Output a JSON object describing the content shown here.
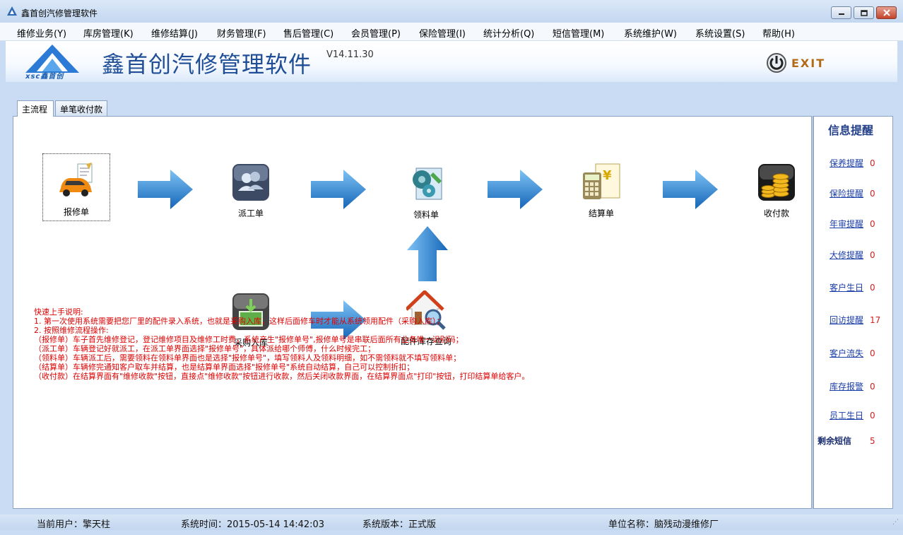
{
  "window": {
    "title": "鑫首创汽修管理软件"
  },
  "menu": [
    "维修业务(Y)",
    "库房管理(K)",
    "维修结算(J)",
    "财务管理(F)",
    "售后管理(C)",
    "会员管理(P)",
    "保险管理(I)",
    "统计分析(Q)",
    "短信管理(M)",
    "系统维护(W)",
    "系统设置(S)",
    "帮助(H)"
  ],
  "header": {
    "logo_text": "xsc鑫首创",
    "app_name": "鑫首创汽修管理软件",
    "version": "V14.11.30",
    "exit_label": "EXIT"
  },
  "tabs": [
    "主流程",
    "单笔收付款"
  ],
  "flow": {
    "repair_order": "报修单",
    "dispatch": "派工单",
    "picking": "领料单",
    "settlement": "结算单",
    "payment": "收付款",
    "purchase_in": "采购入库",
    "parts_query": "配件库存查询"
  },
  "instructions": [
    "快速上手说明:",
    "1.   第一次使用系统需要把您厂里的配件录入系统，也就是采购入库，这样后面修车时才能从系统领用配件（采购入库）；",
    "2.   按照维修流程操作:",
    "      （报修单）车子首先维修登记，登记维修项目及维修工时费，系统产生\"报修单号\",报修单号是串联后面所有业务唯一识别码；",
    "      （派工单）车辆登记好就派工，在派工单界面选择\"报修单号\"，具体派给哪个师傅，什么时候完工；",
    "      （领料单）车辆派工后，需要领料在领料单界面也是选择\"报修单号\"，填写领料人及领料明细，如不需领料就不填写领料单；",
    "      （结算单）车辆修完通知客户取车并结算，也是结算单界面选择\"报修单号\"系统自动结算，自己可以控制折扣；",
    "      （收付款）在结算界面有\"维修收款\"按钮，直接点\"维修收款\"按钮进行收款，然后关闭收款界面，在结算界面点\"打印\"按钮，打印结算单给客户。"
  ],
  "sidebar": {
    "title": "信息提醒",
    "items": [
      {
        "label": "保养提醒",
        "count": "0"
      },
      {
        "label": "保险提醒",
        "count": "0"
      },
      {
        "label": "年审提醒",
        "count": "0"
      },
      {
        "label": "大修提醒",
        "count": "0"
      },
      {
        "label": "客户生日",
        "count": "0"
      },
      {
        "label": "回访提醒",
        "count": "17"
      },
      {
        "label": "客户流失",
        "count": "0"
      },
      {
        "label": "库存报警",
        "count": "0"
      },
      {
        "label": "员工生日",
        "count": "0"
      }
    ],
    "sms_label": "剩余短信",
    "sms_count": "5"
  },
  "status": {
    "user": "当前用户：擎天柱",
    "time": "系统时间：2015-05-14 14:42:03",
    "version": "系统版本：正式版",
    "company": "单位名称：脑残动漫维修厂"
  }
}
